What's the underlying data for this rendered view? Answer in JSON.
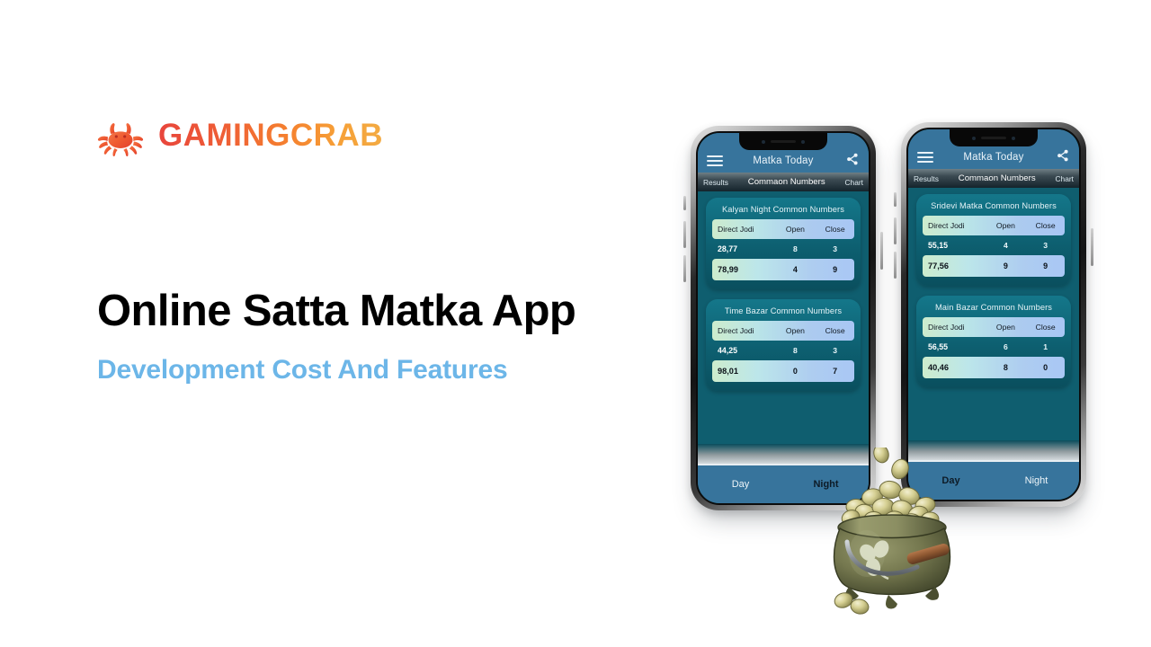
{
  "brand": {
    "name": "GAMINGCRAB",
    "icon": "crab-icon",
    "gradient_from": "#e8453c",
    "gradient_to": "#f3ab43"
  },
  "hero": {
    "headline": "Online Satta Matka App",
    "subheadline": "Development Cost And Features",
    "headline_color": "#000000",
    "subheadline_color": "#6cb6e8"
  },
  "theme": {
    "appbar_color": "#37749c",
    "screen_bg": "#0f5e6f",
    "card_bg": "#0d5f70",
    "row_gradient_from": "#cdeccd",
    "row_gradient_to": "#a9c7f5"
  },
  "phones": [
    {
      "id": "phone-1",
      "appbar": {
        "menu_icon": "hamburger-icon",
        "title": "Matka Today",
        "share_icon": "share-icon"
      },
      "tabs": [
        {
          "label": "Results",
          "active": false
        },
        {
          "label": "Commaon Numbers",
          "active": true
        },
        {
          "label": "Chart",
          "active": false
        }
      ],
      "cards": [
        {
          "title": "Kalyan Night Common Numbers",
          "columns": [
            "Direct Jodi",
            "Open",
            "Close"
          ],
          "rows": [
            {
              "jodi": "28,77",
              "open": "8",
              "close": "3",
              "style": "dark"
            },
            {
              "jodi": "78,99",
              "open": "4",
              "close": "9",
              "style": "light"
            }
          ]
        },
        {
          "title": "Time Bazar Common Numbers",
          "columns": [
            "Direct Jodi",
            "Open",
            "Close"
          ],
          "rows": [
            {
              "jodi": "44,25",
              "open": "8",
              "close": "3",
              "style": "dark"
            },
            {
              "jodi": "98,01",
              "open": "0",
              "close": "7",
              "style": "light"
            }
          ]
        }
      ],
      "bottom_nav": [
        {
          "label": "Day",
          "active": false
        },
        {
          "label": "Night",
          "active": true
        }
      ]
    },
    {
      "id": "phone-2",
      "appbar": {
        "menu_icon": "hamburger-icon",
        "title": "Matka Today",
        "share_icon": "share-icon"
      },
      "tabs": [
        {
          "label": "Results",
          "active": false
        },
        {
          "label": "Commaon Numbers",
          "active": true
        },
        {
          "label": "Chart",
          "active": false
        }
      ],
      "cards": [
        {
          "title": "Sridevi Matka  Common Numbers",
          "columns": [
            "Direct Jodi",
            "Open",
            "Close"
          ],
          "rows": [
            {
              "jodi": "55,15",
              "open": "4",
              "close": "3",
              "style": "dark"
            },
            {
              "jodi": "77,56",
              "open": "9",
              "close": "9",
              "style": "light"
            }
          ]
        },
        {
          "title": "Main Bazar Common Numbers",
          "columns": [
            "Direct Jodi",
            "Open",
            "Close"
          ],
          "rows": [
            {
              "jodi": "56,55",
              "open": "6",
              "close": "1",
              "style": "dark"
            },
            {
              "jodi": "40,46",
              "open": "8",
              "close": "0",
              "style": "light"
            }
          ]
        }
      ],
      "bottom_nav": [
        {
          "label": "Day",
          "active": true
        },
        {
          "label": "Night",
          "active": false
        }
      ]
    }
  ],
  "decoration": {
    "pot_of_gold": "pot-of-gold-illustration"
  }
}
